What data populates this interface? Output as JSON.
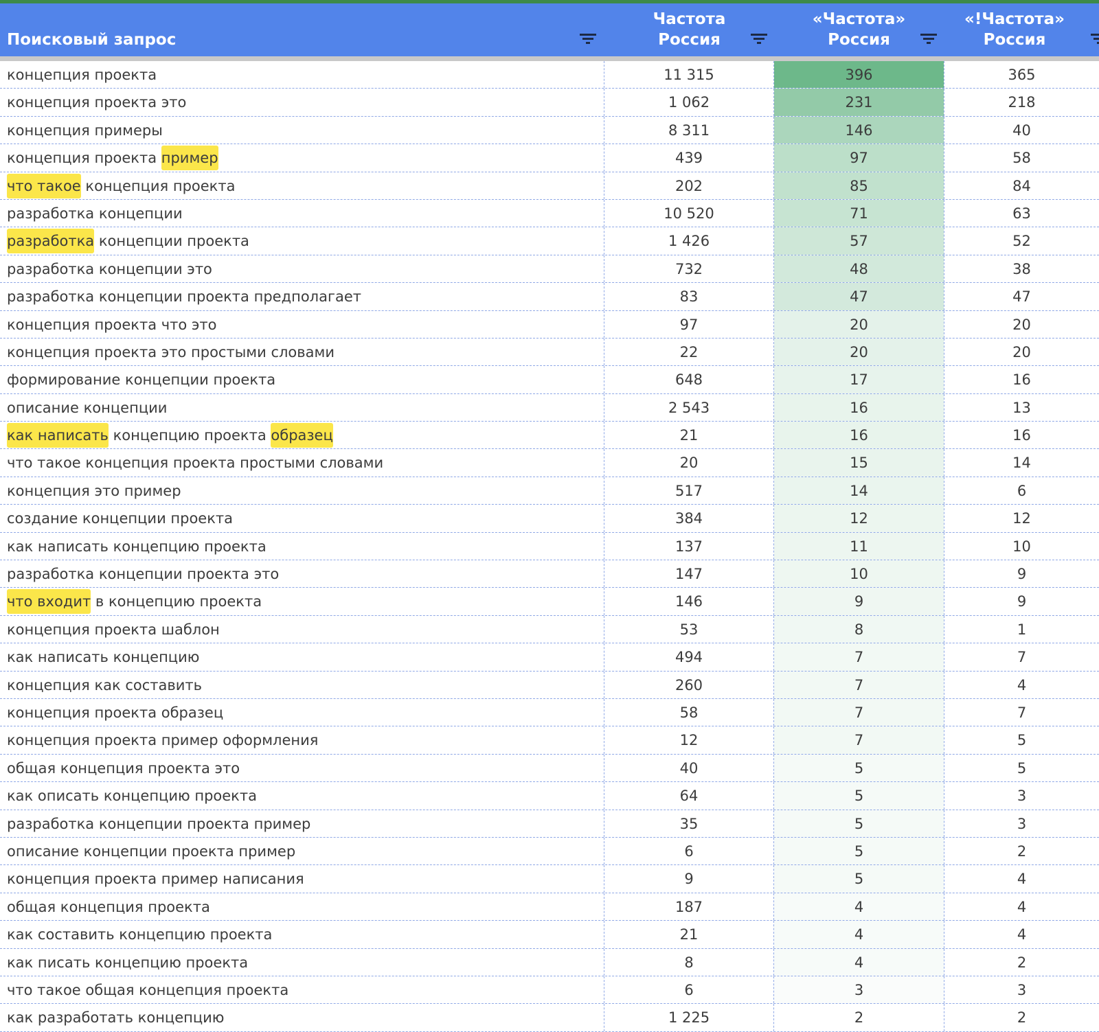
{
  "columns": [
    {
      "label": "Поисковый запрос"
    },
    {
      "label_1": "Частота",
      "label_2": "Россия"
    },
    {
      "label_1": "«Частота»",
      "label_2": "Россия"
    },
    {
      "label_1": "«!Частота»",
      "label_2": "Россия"
    }
  ],
  "colors": {
    "header": "#5284ea",
    "highlight": "#fbe64a",
    "scale_max": "#6db88a",
    "scale_min": "#ffffff"
  },
  "rows": [
    {
      "query": "концепция проекта",
      "freq": "11 315",
      "quoted": "396",
      "exact": "365",
      "highlights": []
    },
    {
      "query": "концепция проекта это",
      "freq": "1 062",
      "quoted": "231",
      "exact": "218",
      "highlights": []
    },
    {
      "query": "концепция примеры",
      "freq": "8 311",
      "quoted": "146",
      "exact": "40",
      "highlights": []
    },
    {
      "query": "концепция проекта пример",
      "freq": "439",
      "quoted": "97",
      "exact": "58",
      "highlights": [
        "пример"
      ]
    },
    {
      "query": "что такое концепция проекта",
      "freq": "202",
      "quoted": "85",
      "exact": "84",
      "highlights": [
        "что такое"
      ]
    },
    {
      "query": "разработка концепции",
      "freq": "10 520",
      "quoted": "71",
      "exact": "63",
      "highlights": []
    },
    {
      "query": "разработка концепции проекта",
      "freq": "1 426",
      "quoted": "57",
      "exact": "52",
      "highlights": [
        "разработка"
      ]
    },
    {
      "query": "разработка концепции это",
      "freq": "732",
      "quoted": "48",
      "exact": "38",
      "highlights": []
    },
    {
      "query": "разработка концепции проекта предполагает",
      "freq": "83",
      "quoted": "47",
      "exact": "47",
      "highlights": []
    },
    {
      "query": "концепция проекта что это",
      "freq": "97",
      "quoted": "20",
      "exact": "20",
      "highlights": []
    },
    {
      "query": "концепция проекта это простыми словами",
      "freq": "22",
      "quoted": "20",
      "exact": "20",
      "highlights": []
    },
    {
      "query": "формирование концепции проекта",
      "freq": "648",
      "quoted": "17",
      "exact": "16",
      "highlights": []
    },
    {
      "query": "описание концепции",
      "freq": "2 543",
      "quoted": "16",
      "exact": "13",
      "highlights": []
    },
    {
      "query": "как написать концепцию проекта образец",
      "freq": "21",
      "quoted": "16",
      "exact": "16",
      "highlights": [
        "как написать",
        "образец"
      ]
    },
    {
      "query": "что такое концепция проекта простыми словами",
      "freq": "20",
      "quoted": "15",
      "exact": "14",
      "highlights": []
    },
    {
      "query": "концепция это пример",
      "freq": "517",
      "quoted": "14",
      "exact": "6",
      "highlights": []
    },
    {
      "query": "создание концепции проекта",
      "freq": "384",
      "quoted": "12",
      "exact": "12",
      "highlights": []
    },
    {
      "query": "как написать концепцию проекта",
      "freq": "137",
      "quoted": "11",
      "exact": "10",
      "highlights": []
    },
    {
      "query": "разработка концепции проекта это",
      "freq": "147",
      "quoted": "10",
      "exact": "9",
      "highlights": []
    },
    {
      "query": "что входит в концепцию проекта",
      "freq": "146",
      "quoted": "9",
      "exact": "9",
      "highlights": [
        "что входит"
      ]
    },
    {
      "query": "концепция проекта шаблон",
      "freq": "53",
      "quoted": "8",
      "exact": "1",
      "highlights": []
    },
    {
      "query": "как написать концепцию",
      "freq": "494",
      "quoted": "7",
      "exact": "7",
      "highlights": []
    },
    {
      "query": "концепция как составить",
      "freq": "260",
      "quoted": "7",
      "exact": "4",
      "highlights": []
    },
    {
      "query": "концепция проекта образец",
      "freq": "58",
      "quoted": "7",
      "exact": "7",
      "highlights": []
    },
    {
      "query": "концепция проекта пример оформления",
      "freq": "12",
      "quoted": "7",
      "exact": "5",
      "highlights": []
    },
    {
      "query": "общая концепция проекта это",
      "freq": "40",
      "quoted": "5",
      "exact": "5",
      "highlights": []
    },
    {
      "query": "как описать концепцию проекта",
      "freq": "64",
      "quoted": "5",
      "exact": "3",
      "highlights": []
    },
    {
      "query": "разработка концепции проекта пример",
      "freq": "35",
      "quoted": "5",
      "exact": "3",
      "highlights": []
    },
    {
      "query": "описание концепции проекта пример",
      "freq": "6",
      "quoted": "5",
      "exact": "2",
      "highlights": []
    },
    {
      "query": "концепция проекта пример написания",
      "freq": "9",
      "quoted": "5",
      "exact": "4",
      "highlights": []
    },
    {
      "query": "общая концепция проекта",
      "freq": "187",
      "quoted": "4",
      "exact": "4",
      "highlights": []
    },
    {
      "query": "как составить концепцию проекта",
      "freq": "21",
      "quoted": "4",
      "exact": "4",
      "highlights": []
    },
    {
      "query": "как писать концепцию проекта",
      "freq": "8",
      "quoted": "4",
      "exact": "2",
      "highlights": []
    },
    {
      "query": "что такое общая концепция проекта",
      "freq": "6",
      "quoted": "3",
      "exact": "3",
      "highlights": []
    },
    {
      "query": "как разработать концепцию",
      "freq": "1 225",
      "quoted": "2",
      "exact": "2",
      "highlights": []
    }
  ]
}
